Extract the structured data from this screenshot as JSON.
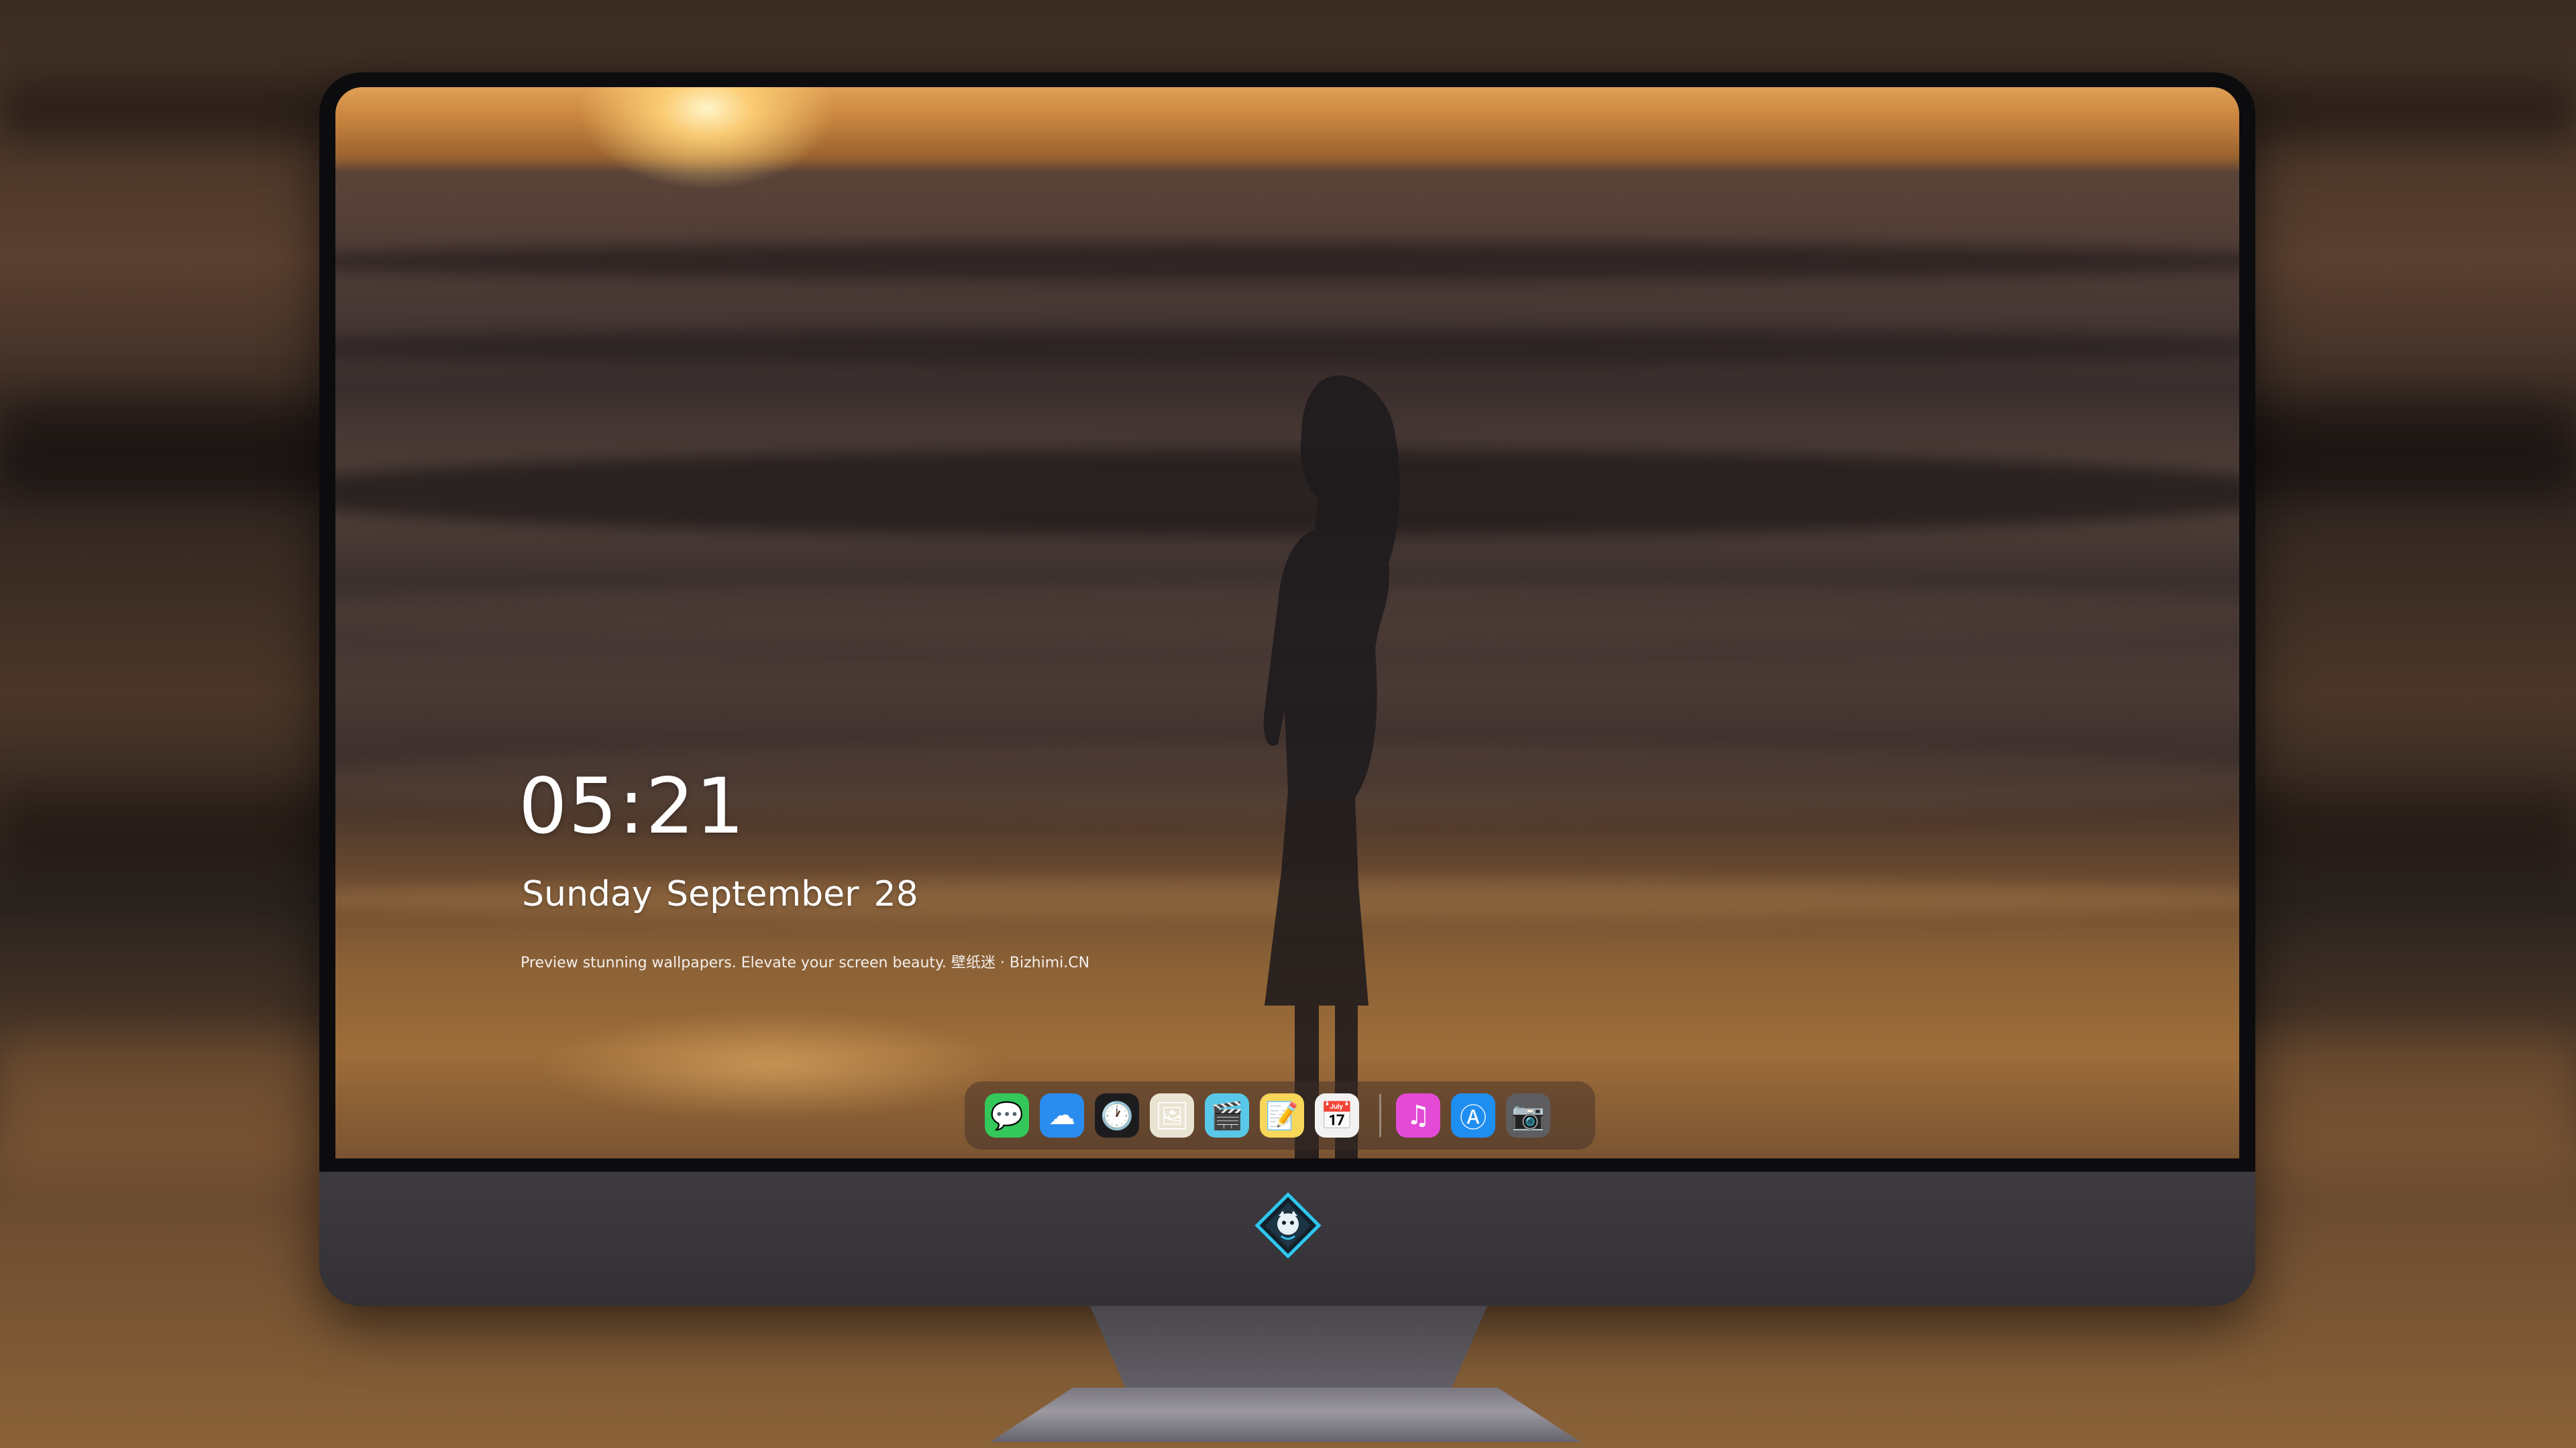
{
  "lockscreen": {
    "time": "05:21",
    "weekday": "Sunday",
    "month": "September",
    "day": "28",
    "tagline": "Preview stunning wallpapers. Elevate your screen beauty. 壁纸迷 · Bizhimi.CN"
  },
  "dock": {
    "items": [
      {
        "name": "messages-icon",
        "glyph": "💬",
        "color": "#34c759"
      },
      {
        "name": "weather-icon",
        "glyph": "☁",
        "color": "#2b8cf0"
      },
      {
        "name": "clock-icon",
        "glyph": "🕐",
        "color": "#1c1c1e"
      },
      {
        "name": "preview-icon",
        "glyph": "🖼",
        "color": "#e9e3d2"
      },
      {
        "name": "clips-icon",
        "glyph": "🎬",
        "color": "#59c8e8"
      },
      {
        "name": "notes-icon",
        "glyph": "📝",
        "color": "#f7d65a"
      },
      {
        "name": "calendar-icon",
        "glyph": "📅",
        "color": "#f2f2f2"
      },
      {
        "name": "itunes-icon",
        "glyph": "♫",
        "color": "#e34bd6"
      },
      {
        "name": "app-store-icon",
        "glyph": "Ⓐ",
        "color": "#1f8ef1"
      },
      {
        "name": "camera-icon",
        "glyph": "📷",
        "color": "#5e5e60"
      }
    ]
  },
  "colors": {
    "monitor_bezel": "#0c0c0e",
    "monitor_chin": "#3d3a40",
    "logo_accent": "#2ec7f0"
  }
}
